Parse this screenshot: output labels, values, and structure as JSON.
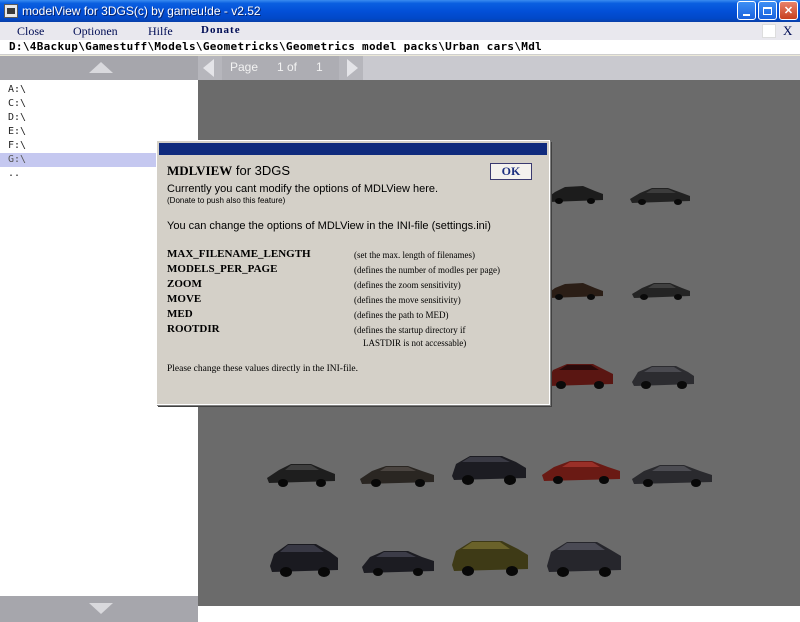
{
  "window": {
    "title": "modelView for 3DGS(c) by gameu!de - v2.52"
  },
  "menu": {
    "close_label": "Close",
    "optionen_label": "Optionen",
    "hilfe_label": "Hilfe",
    "donate_label": "Donate",
    "x_label": "X"
  },
  "path": {
    "current": "D:\\4Backup\\Gamestuff\\Models\\Geometricks\\Geometrics model packs\\Urban cars\\Mdl"
  },
  "drives": {
    "items": [
      {
        "label": "A:\\"
      },
      {
        "label": "C:\\"
      },
      {
        "label": "D:\\"
      },
      {
        "label": "E:\\"
      },
      {
        "label": "F:\\"
      },
      {
        "label": "G:\\",
        "selected": true
      },
      {
        "label": ".."
      }
    ]
  },
  "pager": {
    "label": "Page",
    "current": "1",
    "of": "of",
    "total": "1"
  },
  "dialog": {
    "app_name": "MDLVIEW",
    "app_suffix": "for 3DGS",
    "ok_label": "OK",
    "line1": "Currently you cant modify the options of MDLView here.",
    "line2": "(Donate to push also this feature)",
    "line3": "You can change the options of MDLView in the INI-file (settings.ini)",
    "options": [
      {
        "key": "MAX_FILENAME_LENGTH",
        "desc": "(set the max. length of filenames)"
      },
      {
        "key": "MODELS_PER_PAGE",
        "desc": "(defines the number of modles per page)"
      },
      {
        "key": "ZOOM",
        "desc": "(defines the zoom sensitivity)"
      },
      {
        "key": "MOVE",
        "desc": "(defines the move sensitivity)"
      },
      {
        "key": "MED",
        "desc": "(defines the path to MED)"
      },
      {
        "key": "ROOTDIR",
        "desc": "(defines the startup directory if",
        "desc2": "LASTDIR is not accessable)"
      }
    ],
    "footer": "Please change these values directly in the INI-file."
  },
  "colors": {
    "titlebar": "#0350d8",
    "dialog_bg": "#d4d0c8",
    "viewer_bg": "#6b6b6b",
    "selected_drive": "#c5c8f0"
  }
}
